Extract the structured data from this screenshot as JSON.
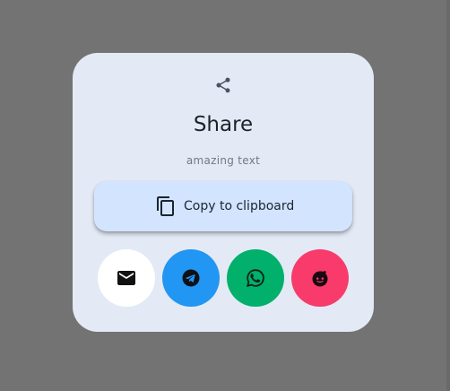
{
  "dialog": {
    "icon": "share-icon",
    "title": "Share",
    "subtitle": "amazing text",
    "copy_button": {
      "icon": "copy-icon",
      "label": "Copy to clipboard"
    },
    "share_targets": [
      {
        "name": "email",
        "icon": "email-icon",
        "color": "#ffffff"
      },
      {
        "name": "telegram",
        "icon": "telegram-icon",
        "color": "#2196f3"
      },
      {
        "name": "whatsapp",
        "icon": "whatsapp-icon",
        "color": "#00b06b"
      },
      {
        "name": "reddit",
        "icon": "reddit-icon",
        "color": "#f83b6b"
      }
    ]
  },
  "colors": {
    "backdrop": "#737373",
    "dialog_background": "#e3eaf5",
    "copy_button_background": "#d3e4ff"
  }
}
